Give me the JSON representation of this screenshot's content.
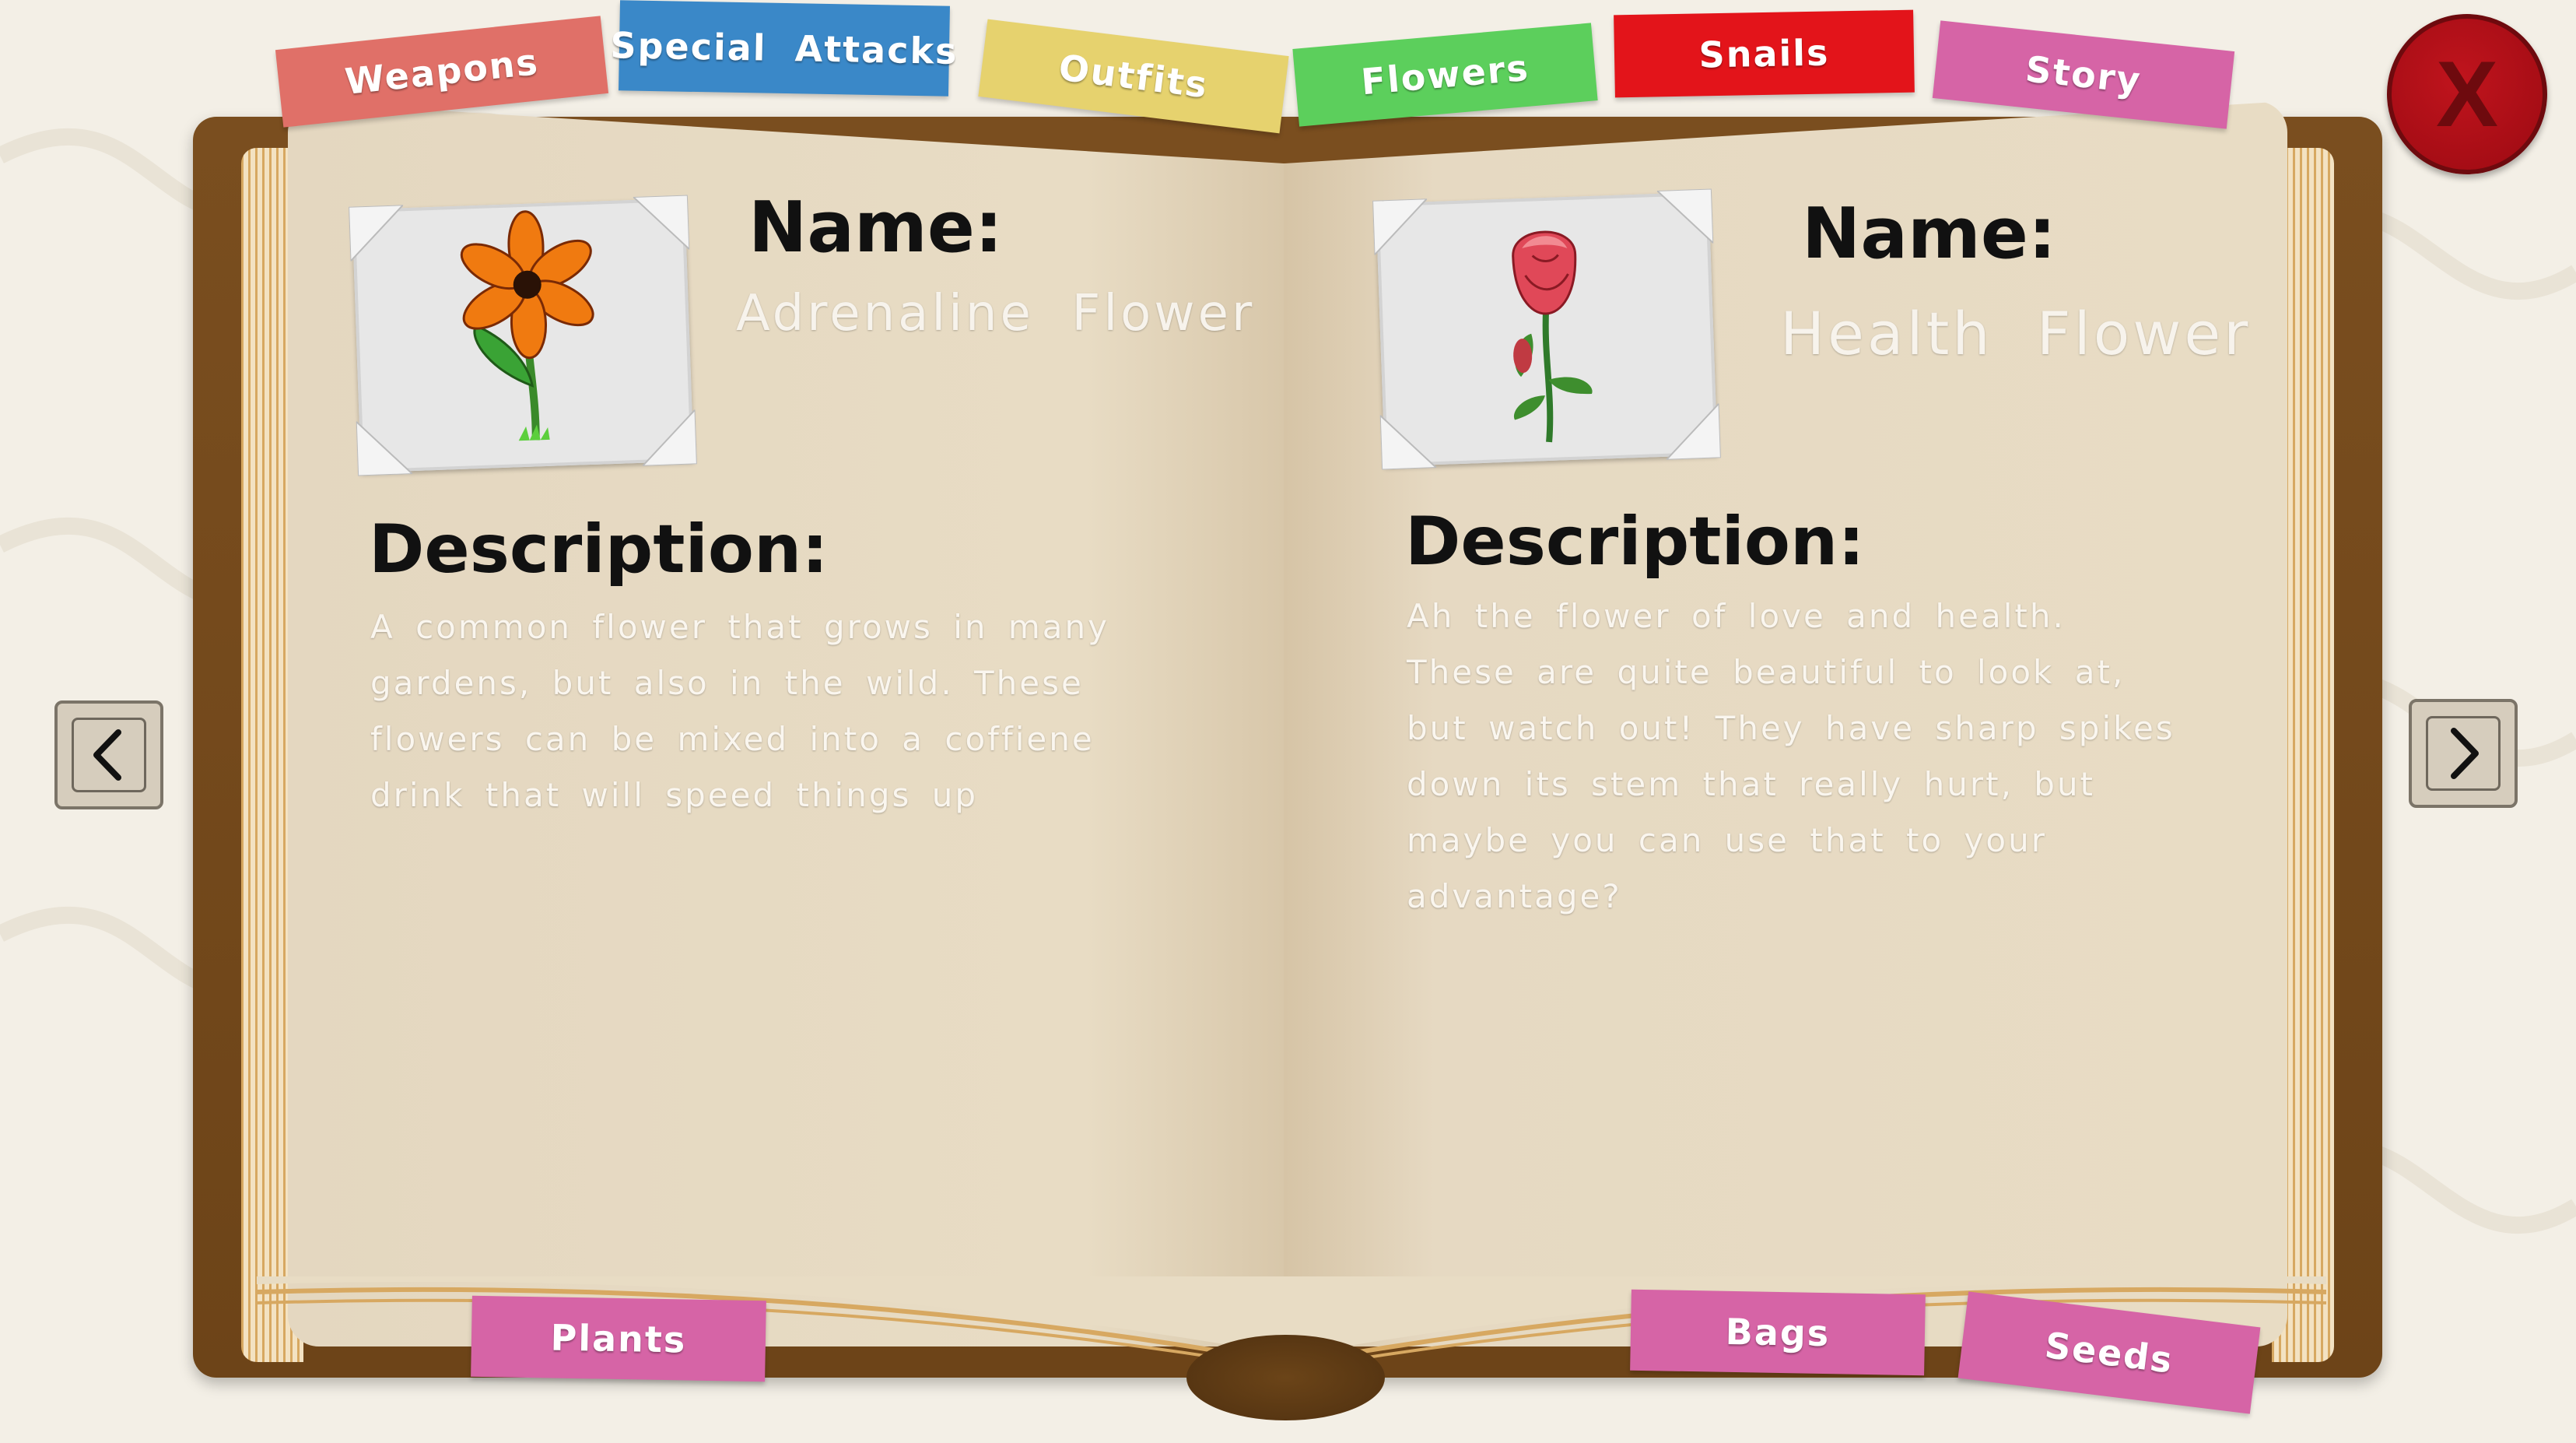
{
  "top_tabs": [
    {
      "label": "Weapons",
      "color": "#e07068"
    },
    {
      "label": "Special  Attacks",
      "color": "#3a88c8"
    },
    {
      "label": "Outfits",
      "color": "#e6d26e"
    },
    {
      "label": "Flowers",
      "color": "#5ccf5c"
    },
    {
      "label": "Snails",
      "color": "#e3141a"
    },
    {
      "label": "Story",
      "color": "#d664a6"
    }
  ],
  "bottom_tabs": [
    {
      "label": "Plants",
      "color": "#d664a6"
    },
    {
      "label": "Bags",
      "color": "#d664a6"
    },
    {
      "label": "Seeds",
      "color": "#d664a6"
    }
  ],
  "left_entry": {
    "name_label": "Name:",
    "name": "Adrenaline  Flower",
    "description_label": "Description:",
    "description": "A common flower that grows in many gardens, but also in the wild. These flowers can be mixed into a coffiene drink that will speed things up",
    "icon": "orange-daisy-flower-icon"
  },
  "right_entry": {
    "name_label": "Name:",
    "name": "Health  Flower",
    "description_label": "Description:",
    "description": "Ah the flower of love and health. These are quite beautiful to look at, but watch out! They have sharp spikes down its stem that really hurt, but maybe you can use that to your advantage?",
    "icon": "red-rose-icon"
  },
  "close_button": {
    "label": "X",
    "color": "#c0141d"
  },
  "colors": {
    "cover": "#7a4e1f",
    "page": "#e8dcc4",
    "background": "#f3efe6"
  }
}
